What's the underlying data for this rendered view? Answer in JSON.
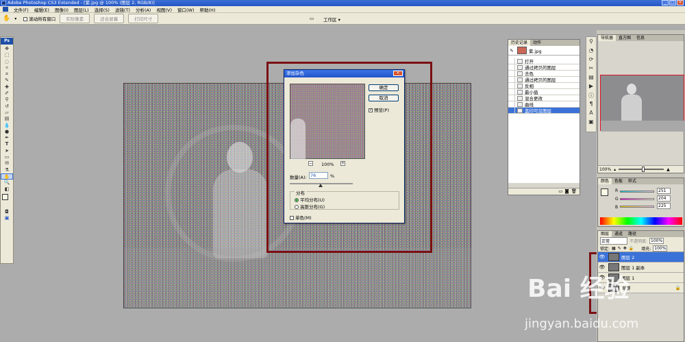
{
  "app": {
    "title": "Adobe Photoshop CS3 Extended - [紫.jpg @ 100% (图层 2, RGB/8)]"
  },
  "menu": [
    "文件(F)",
    "编辑(E)",
    "图像(I)",
    "图层(L)",
    "选择(S)",
    "滤镜(T)",
    "分析(A)",
    "视图(V)",
    "窗口(W)",
    "帮助(H)"
  ],
  "options": {
    "scroll_all": "滚动所有窗口",
    "btn_actual": "实际像素",
    "btn_fit": "适合屏幕",
    "btn_print": "打印尺寸",
    "workspace": "工作区 ▾"
  },
  "toolbox": {
    "logo": "Ps"
  },
  "dialog": {
    "title": "添加杂色",
    "ok": "确定",
    "cancel": "取消",
    "preview_label": "预览(P)",
    "zoom": "100%",
    "amount_label": "数量(A):",
    "amount_value": "76",
    "amount_unit": "%",
    "distribution_label": "分布",
    "uniform": "平均分布(U)",
    "gaussian": "高斯分布(G)",
    "mono": "单色(M)"
  },
  "history": {
    "tabs": [
      "历史记录",
      "动作"
    ],
    "snapshot": "紫.jpg",
    "items": [
      "打开",
      "通过拷贝的图层",
      "去色",
      "通过拷贝的图层",
      "反相",
      "最小值",
      "混合更改",
      "曲线",
      "盖印可见图层"
    ]
  },
  "navigator": {
    "tabs": [
      "导航器",
      "直方图",
      "信息"
    ],
    "zoom": "100%"
  },
  "color": {
    "tabs": [
      "颜色",
      "色板",
      "样式"
    ],
    "r": "251",
    "g": "204",
    "b": "225",
    "r_label": "R",
    "g_label": "G",
    "b_label": "B"
  },
  "layers": {
    "tabs": [
      "图层",
      "通道",
      "路径"
    ],
    "mode": "正常",
    "opacity_label": "不透明度:",
    "opacity": "100%",
    "lock_label": "锁定:",
    "fill_label": "填充:",
    "fill": "100%",
    "items": [
      "图层 2",
      "图层 1 副本",
      "图层 1",
      "背景"
    ]
  },
  "watermark": {
    "main": "Bai 经验",
    "sub": "jingyan.baidu.com"
  }
}
